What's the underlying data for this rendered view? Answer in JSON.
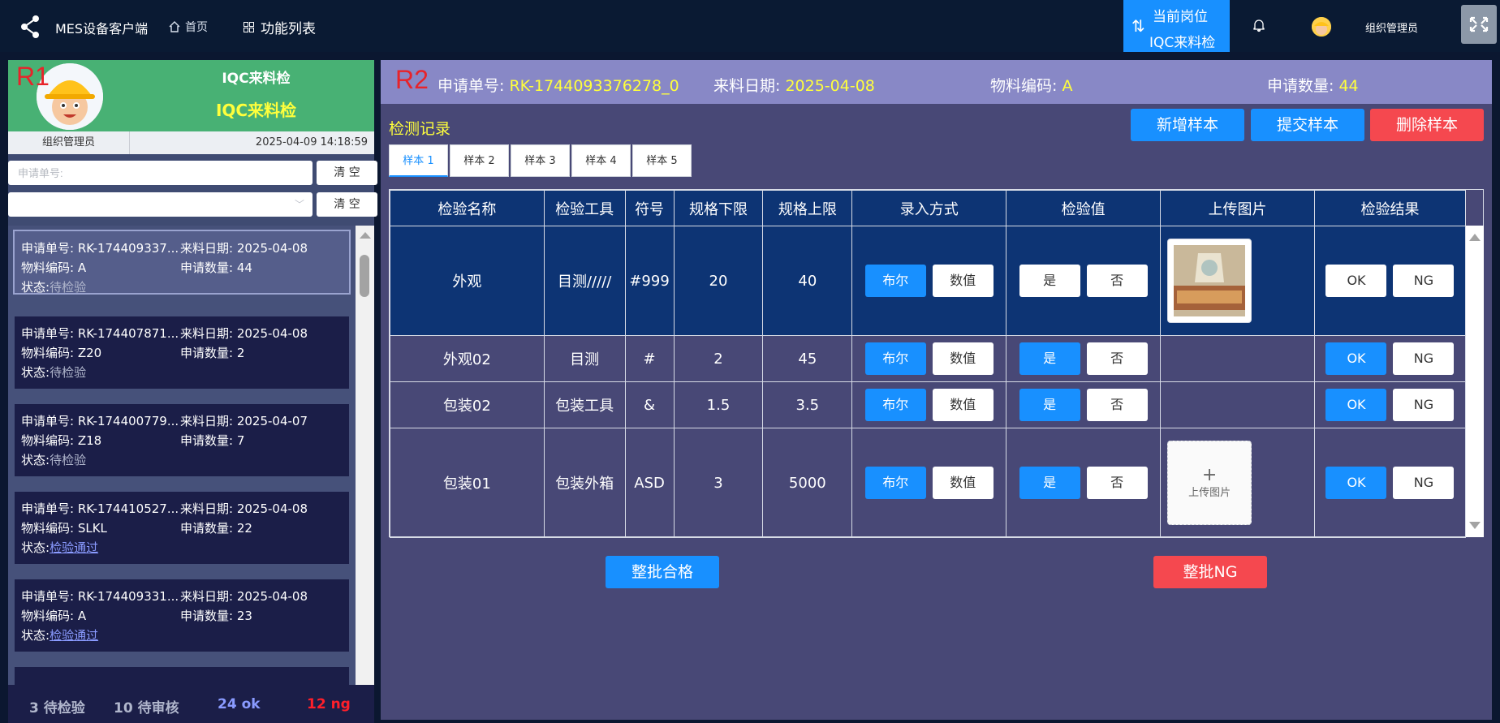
{
  "topbar": {
    "app_title": "MES设备客户端",
    "nav_home": "首页",
    "nav_func": "功能列表",
    "station_label": "当前岗位",
    "station_value": "IQC来料检",
    "username": "组织管理员",
    "accent": "#1890ff"
  },
  "left": {
    "region_label": "R1",
    "title": "IQC来料检",
    "subtitle": "IQC来料检",
    "org": "组织管理员",
    "datetime": "2025-04-09 14:18:59",
    "search_placeholder": "申请单号:",
    "clear_label": "清 空",
    "clear_label_2": "清 空",
    "labels": {
      "req_no": "申请单号:",
      "date": "来料日期:",
      "mat": "物料编码:",
      "qty": "申请数量:",
      "state": "状态:"
    },
    "items": [
      {
        "req_no": "RK-174409337...",
        "date": "2025-04-08",
        "mat": "A",
        "qty": "44",
        "state": "待检验"
      },
      {
        "req_no": "RK-174407871...",
        "date": "2025-04-08",
        "mat": "Z20",
        "qty": "2",
        "state": "待检验"
      },
      {
        "req_no": "RK-174400779...",
        "date": "2025-04-07",
        "mat": "Z18",
        "qty": "7",
        "state": "待检验"
      },
      {
        "req_no": "RK-174410527...",
        "date": "2025-04-08",
        "mat": "SLKL",
        "qty": "22",
        "state": "检验通过"
      },
      {
        "req_no": "RK-174409331...",
        "date": "2025-04-08",
        "mat": "A",
        "qty": "23",
        "state": "检验通过"
      }
    ],
    "stats": {
      "pending": "3 待检验",
      "review": "10 待审核",
      "ok": "24 ok",
      "ng": "12 ng"
    }
  },
  "right": {
    "region_label": "R2",
    "req_no_label": "申请单号:",
    "req_no": "RK-1744093376278_0",
    "date_label": "来料日期:",
    "date": "2025-04-08",
    "mat_label": "物料编码:",
    "mat": "A",
    "qty_label": "申请数量:",
    "qty": "44",
    "record_title": "检测记录",
    "btn_add": "新增样本",
    "btn_submit": "提交样本",
    "btn_delete": "删除样本",
    "tabs": [
      "样本 1",
      "样本 2",
      "样本 3",
      "样本 4",
      "样本 5"
    ],
    "columns": [
      "检验名称",
      "检验工具",
      "符号",
      "规格下限",
      "规格上限",
      "录入方式",
      "检验值",
      "上传图片",
      "检验结果"
    ],
    "rows": [
      {
        "name": "外观",
        "tool": "目测/////",
        "symbol": "#999",
        "low": "20",
        "high": "40"
      },
      {
        "name": "外观02",
        "tool": "目测",
        "symbol": "#",
        "low": "2",
        "high": "45"
      },
      {
        "name": "包装02",
        "tool": "包装工具",
        "symbol": "&",
        "low": "1.5",
        "high": "3.5"
      },
      {
        "name": "包装01",
        "tool": "包装外箱",
        "symbol": "ASD",
        "low": "3",
        "high": "5000"
      }
    ],
    "mode_bool": "布尔",
    "mode_num": "数值",
    "val_yes": "是",
    "val_no": "否",
    "res_ok": "OK",
    "res_ng": "NG",
    "upload_label": "上传图片",
    "batch_pass": "整批合格",
    "batch_ng": "整批NG"
  }
}
